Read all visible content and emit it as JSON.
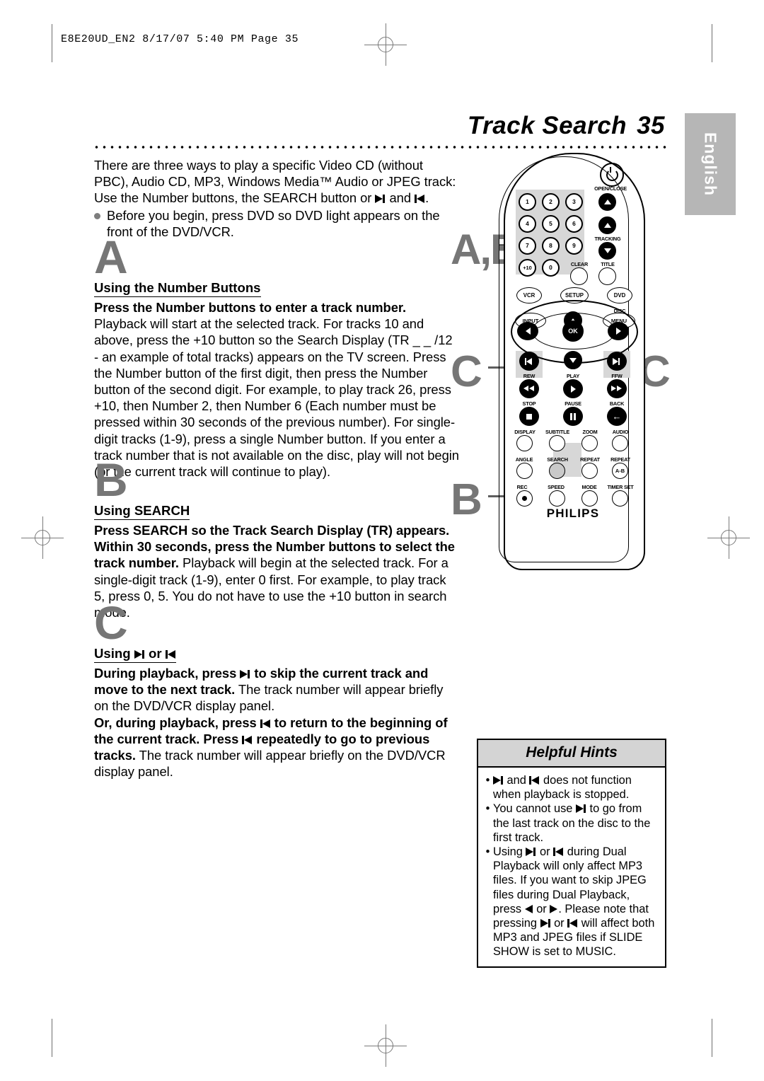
{
  "print_stamp": "E8E20UD_EN2  8/17/07  5:40 PM  Page 35",
  "header": {
    "title": "Track Search",
    "page_number": "35",
    "language_tab": "English"
  },
  "intro": {
    "paragraph": "There are three ways to play a specific Video CD (without PBC), Audio CD, MP3, Windows Media™ Audio or JPEG track: Use the Number buttons, the SEARCH button or ",
    "paragraph_tail": " and ",
    "paragraph_end": ".",
    "bullet": "Before you begin, press DVD so DVD light appears on the front of the DVD/VCR."
  },
  "sections": [
    {
      "letter": "A",
      "subhead": "Using the Number Buttons",
      "lead_bold": "Press the Number buttons to enter a track number.",
      "body": " Playback will start at the selected track. For tracks 10 and above, press the +10 button so the Search Display (TR _ _ /12 - an example of total tracks)  appears on the TV screen. Press the Number button of the first digit, then press the Number button of the second digit. For example, to play track 26, press +10, then Number 2, then Number 6 (Each number must be pressed within 30 seconds of the previous number). For single-digit tracks (1-9), press a single Number button. If you enter a track number that is not available on the disc, play will not begin (or the current track will continue to play)."
    },
    {
      "letter": "B",
      "subhead": "Using SEARCH",
      "lead_bold": "Press SEARCH so the Track Search Display (TR) appears. Within 30 seconds, press the Number buttons to select the track number.",
      "body": " Playback will begin at the selected track. For a single-digit track (1-9), enter 0 first. For example, to play track 5, press 0, 5. You do not have to use the +10 button in search mode."
    },
    {
      "letter": "C",
      "subhead_prefix": "Using ",
      "subhead_mid": " or ",
      "bold_1": "During playback, press ",
      "bold_1b": " to skip the current track and move to the next track.",
      "plain_1": " The track number will appear briefly on the DVD/VCR display panel.",
      "bold_2a": "Or, during playback, press ",
      "bold_2b": " to return to the beginning of the current track. Press ",
      "bold_2c": " repeatedly to go to previous tracks.",
      "plain_2": " The track number will appear briefly on the DVD/VCR display panel."
    }
  ],
  "callouts": [
    "A,B",
    "C",
    "C",
    "B"
  ],
  "remote": {
    "brand": "PHILIPS",
    "power_label": "OPEN/CLOSE",
    "numbers": [
      "1",
      "2",
      "3",
      "4",
      "5",
      "6",
      "7",
      "8",
      "9",
      "+10",
      "0"
    ],
    "right_column": [
      "TRACKING",
      "CLEAR",
      "TITLE"
    ],
    "mode_row": [
      "VCR",
      "SETUP",
      "DVD"
    ],
    "menu_row": [
      "INPUT",
      "DISC",
      "MENU"
    ],
    "ok_label": "OK",
    "transport_top": [
      "REW",
      "PLAY",
      "FFW"
    ],
    "transport_mid": [
      "STOP",
      "PAUSE",
      "BACK"
    ],
    "function_row_1": [
      "DISPLAY",
      "SUBTITLE",
      "ZOOM",
      "AUDIO"
    ],
    "function_row_2": [
      "ANGLE",
      "SEARCH",
      "REPEAT",
      "REPEAT"
    ],
    "repeat_ab": "A-B",
    "function_row_3": [
      "REC",
      "SPEED",
      "MODE",
      "TIMER SET"
    ]
  },
  "hints": {
    "title": "Helpful Hints",
    "bullet_char": "•",
    "items": [
      {
        "pre": " ",
        "post_1": " and ",
        "post_2": " does not function when playback is stopped."
      },
      {
        "pre": "You cannot use ",
        "post_1": " to go from the last track on the disc to the first track."
      },
      {
        "pre": "Using ",
        "post_1": " or ",
        "post_2": " during Dual Playback will only affect MP3 files. If you want to skip JPEG files during Dual Playback, press ",
        "post_3": " or ",
        "post_4": ". Please note that pressing ",
        "post_5": " or ",
        "post_6": " will affect both MP3 and JPEG files if SLIDE SHOW is set to MUSIC."
      }
    ]
  },
  "colors": {
    "callout_gray": "#767676",
    "highlight_gray": "#d7d7d7",
    "lang_tab_gray": "#b6b6b6",
    "hints_head_gray": "#d4d4d4"
  }
}
